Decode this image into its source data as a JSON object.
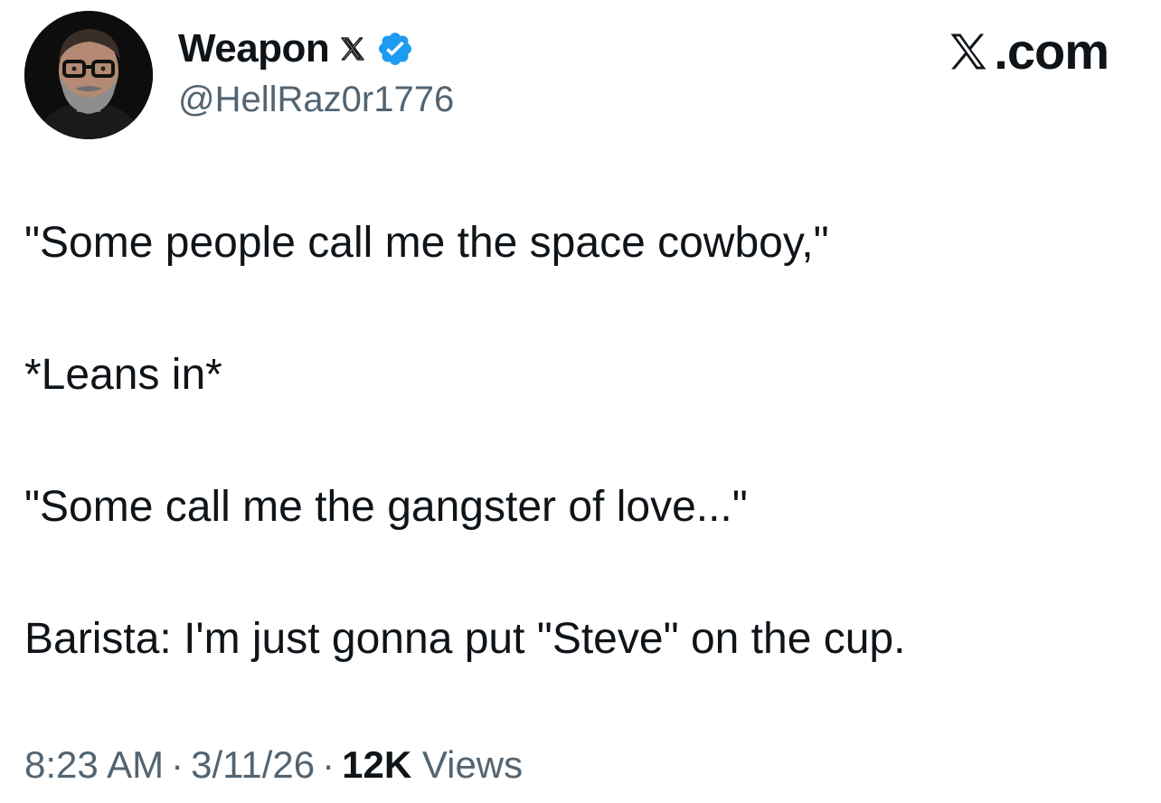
{
  "author": {
    "display_name": "Weapon",
    "handle": "@HellRaz0r1776",
    "verified": true,
    "badge_icon": "verified-badge-icon",
    "badge_color": "#1d9bf0",
    "affiliate_icon": "x-logo-icon"
  },
  "brand": {
    "label": ".com",
    "icon": "x-logo-icon"
  },
  "tweet": {
    "lines": [
      "\"Some people call me the space cowboy,\"",
      "*Leans in*",
      "\"Some call me the gangster of love...\"",
      "Barista: I'm just gonna put \"Steve\" on the cup."
    ]
  },
  "meta": {
    "time": "8:23 AM",
    "separator": "·",
    "date": "3/11/26",
    "views_count": "12K",
    "views_label": "Views"
  },
  "colors": {
    "text": "#0f1419",
    "secondary": "#536471",
    "accent": "#1d9bf0",
    "background": "#ffffff"
  }
}
